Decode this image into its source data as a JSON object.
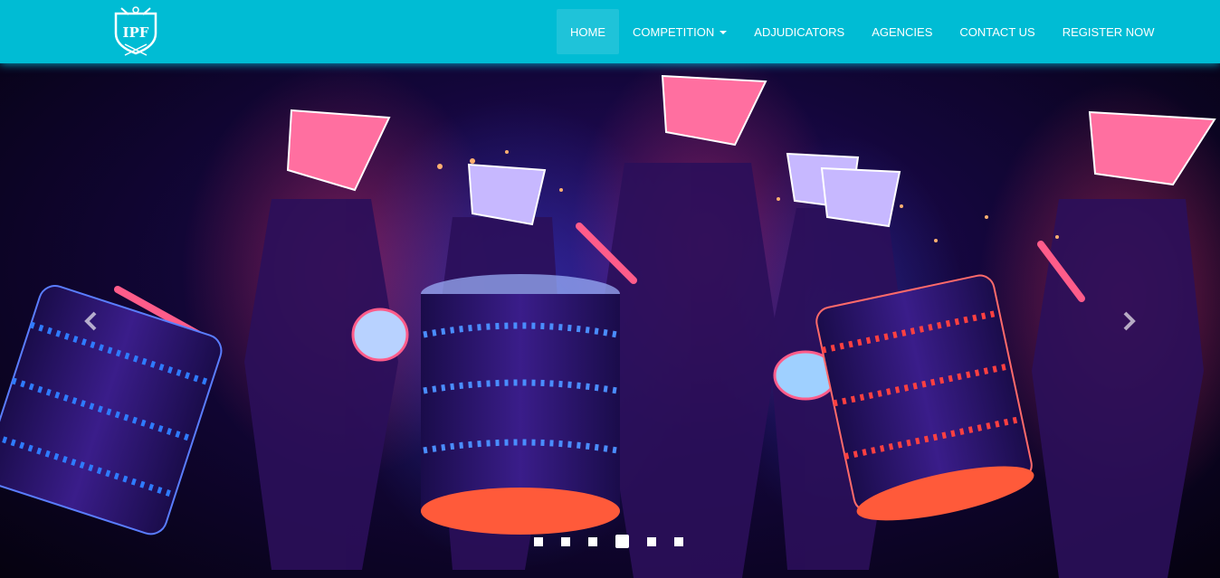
{
  "brand": {
    "logo_text": "IPF",
    "logo_icon": "shield-crest-icon"
  },
  "nav": {
    "items": [
      {
        "label": "HOME",
        "active": true
      },
      {
        "label": "COMPETITION",
        "dropdown": true
      },
      {
        "label": "ADJUDICATORS"
      },
      {
        "label": "AGENCIES"
      },
      {
        "label": "CONTACT US"
      },
      {
        "label": "REGISTER NOW"
      }
    ]
  },
  "carousel": {
    "slide_image": "led-drummers-performance-photo",
    "prev_icon": "chevron-left-icon",
    "next_icon": "chevron-right-icon",
    "slide_count": 6,
    "active_slide": 4
  },
  "colors": {
    "accent": "#00bcd4",
    "active_nav": "#1fc3d9",
    "text": "#ffffff"
  }
}
